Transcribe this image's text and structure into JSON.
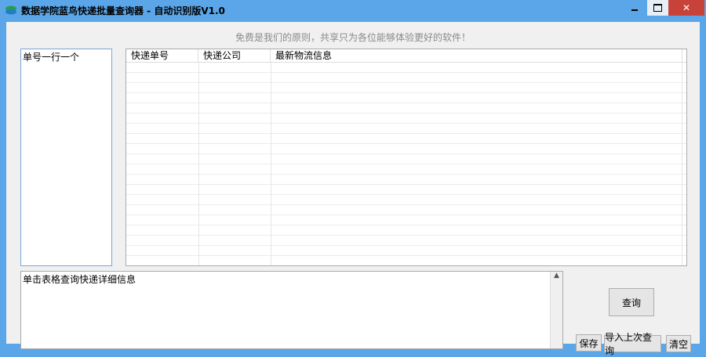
{
  "window": {
    "title": "数据学院蓝鸟快递批量查询器 - 自动识别版V1.0"
  },
  "slogan": "免费是我们的原则，共享只为各位能够体验更好的软件！",
  "numbers_input": {
    "value": "单号一行一个"
  },
  "table": {
    "columns": [
      "快递单号",
      "快递公司",
      "最新物流信息"
    ],
    "rows": []
  },
  "detail_box": {
    "value": "单击表格查询快递详细信息"
  },
  "buttons": {
    "query": "查询",
    "save": "保存",
    "import_last": "导入上次查询",
    "clear": "清空"
  }
}
